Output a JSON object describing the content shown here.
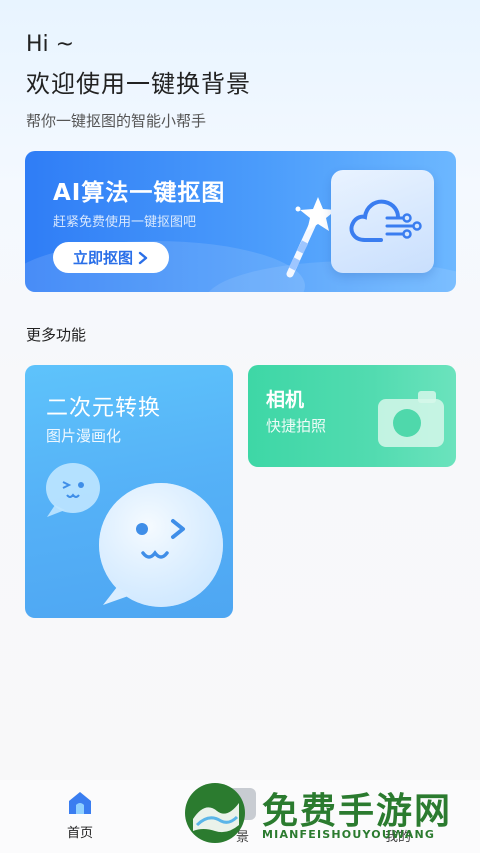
{
  "header": {
    "hi": "Hi ~",
    "title": "欢迎使用一键换背景",
    "subtitle": "帮你一键抠图的智能小帮手"
  },
  "hero": {
    "title": "AI算法一键抠图",
    "subtitle": "赶紧免费使用一键抠图吧",
    "button_label": "立即抠图",
    "icon": "cloud-ai-icon"
  },
  "more": {
    "title": "更多功能"
  },
  "anime_card": {
    "title": "二次元转换",
    "subtitle": "图片漫画化",
    "icon": "chat-face-icon"
  },
  "camera_card": {
    "title": "相机",
    "subtitle": "快捷拍照",
    "icon": "camera-icon"
  },
  "bottom_nav": {
    "home": "首页",
    "background": "景",
    "mine": "我的"
  },
  "watermark": {
    "cn": "免费手游网",
    "en": "MIANFEISHOUYOUWANG"
  },
  "colors": {
    "hero_blue": "#2f7df6",
    "anime_blue": "#55b1f7",
    "camera_green": "#3ed7a6",
    "watermark_green": "#2b7b2f"
  }
}
